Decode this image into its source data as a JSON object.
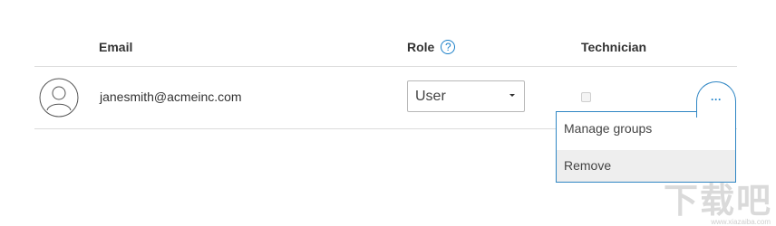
{
  "table": {
    "headers": {
      "email": "Email",
      "role": "Role",
      "technician": "Technician"
    },
    "role_help_icon": "question-circle-icon",
    "rows": [
      {
        "avatar_icon": "user-avatar-icon",
        "email": "janesmith@acmeinc.com",
        "role": "User",
        "technician_checked": false
      }
    ]
  },
  "row_actions": {
    "more_icon": "ellipsis-icon",
    "more_label": "···",
    "menu_items": [
      {
        "label": "Manage groups"
      },
      {
        "label": "Remove"
      }
    ]
  },
  "watermark": {
    "text": "下载吧",
    "url": "www.xiazaiba.com"
  },
  "colors": {
    "accent": "#1a7fc8",
    "divider": "#dcdcdc",
    "hover_bg": "#eeeeee"
  }
}
